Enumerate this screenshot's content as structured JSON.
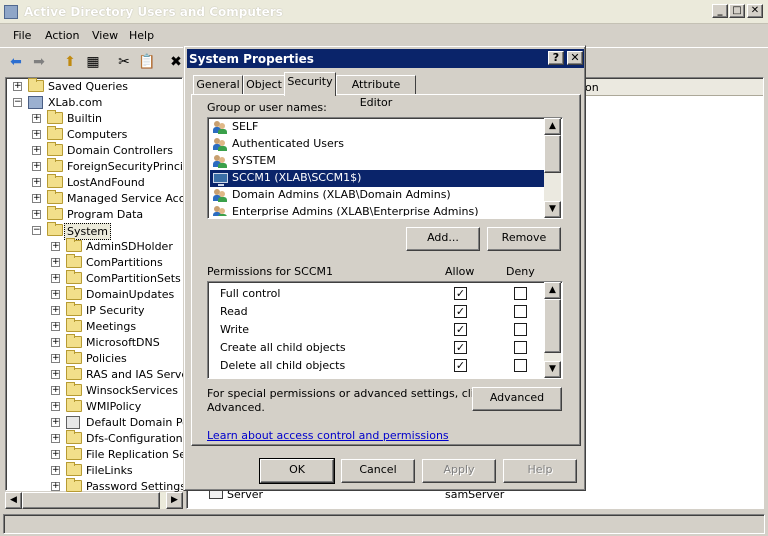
{
  "app": {
    "title": "Active Directory Users and Computers",
    "menu": [
      "File",
      "Action",
      "View",
      "Help"
    ]
  },
  "tree": {
    "nodes": [
      {
        "label": "Saved Queries",
        "level": 0,
        "expander": "+"
      },
      {
        "label": "XLab.com",
        "level": 0,
        "expander": "-",
        "icon": "domain"
      },
      {
        "label": "Builtin",
        "level": 1,
        "expander": "+"
      },
      {
        "label": "Computers",
        "level": 1,
        "expander": "+"
      },
      {
        "label": "Domain Controllers",
        "level": 1,
        "expander": "+"
      },
      {
        "label": "ForeignSecurityPrincipal",
        "level": 1,
        "expander": "+"
      },
      {
        "label": "LostAndFound",
        "level": 1,
        "expander": "+"
      },
      {
        "label": "Managed Service Accou",
        "level": 1,
        "expander": "+"
      },
      {
        "label": "Program Data",
        "level": 1,
        "expander": "+"
      },
      {
        "label": "System",
        "level": 1,
        "expander": "-",
        "selected": true
      },
      {
        "label": "AdminSDHolder",
        "level": 2,
        "expander": "+"
      },
      {
        "label": "ComPartitions",
        "level": 2,
        "expander": "+"
      },
      {
        "label": "ComPartitionSets",
        "level": 2,
        "expander": "+"
      },
      {
        "label": "DomainUpdates",
        "level": 2,
        "expander": "+"
      },
      {
        "label": "IP Security",
        "level": 2,
        "expander": "+"
      },
      {
        "label": "Meetings",
        "level": 2,
        "expander": "+"
      },
      {
        "label": "MicrosoftDNS",
        "level": 2,
        "expander": "+"
      },
      {
        "label": "Policies",
        "level": 2,
        "expander": "+"
      },
      {
        "label": "RAS and IAS Server",
        "level": 2,
        "expander": "+"
      },
      {
        "label": "WinsockServices",
        "level": 2,
        "expander": "+"
      },
      {
        "label": "WMIPolicy",
        "level": 2,
        "expander": "+"
      },
      {
        "label": "Default Domain Polic",
        "level": 2,
        "expander": "+",
        "icon": "policy"
      },
      {
        "label": "Dfs-Configuration",
        "level": 2,
        "expander": "+"
      },
      {
        "label": "File Replication Serv",
        "level": 2,
        "expander": "+"
      },
      {
        "label": "FileLinks",
        "level": 2,
        "expander": "+"
      },
      {
        "label": "Password Settings C",
        "level": 2,
        "expander": "+"
      }
    ]
  },
  "list": {
    "column_fragment": "on",
    "row": {
      "name": "Server",
      "type": "samServer"
    }
  },
  "dialog": {
    "title": "System Properties",
    "help_btn": "?",
    "close_btn": "✕",
    "tabs": [
      "General",
      "Object",
      "Security",
      "Attribute Editor"
    ],
    "active_tab": "Security",
    "group_label": "Group or user names:",
    "users": [
      {
        "name": "SELF",
        "icon": "users"
      },
      {
        "name": "Authenticated Users",
        "icon": "users"
      },
      {
        "name": "SYSTEM",
        "icon": "users"
      },
      {
        "name": "SCCM1 (XLAB\\SCCM1$)",
        "icon": "computer",
        "selected": true
      },
      {
        "name": "Domain Admins (XLAB\\Domain Admins)",
        "icon": "users"
      },
      {
        "name": "Enterprise Admins (XLAB\\Enterprise Admins)",
        "icon": "users"
      }
    ],
    "add_btn": "Add...",
    "remove_btn": "Remove",
    "perm_label": "Permissions for SCCM1",
    "allow_header": "Allow",
    "deny_header": "Deny",
    "permissions": [
      {
        "name": "Full control",
        "allow": true,
        "deny": false
      },
      {
        "name": "Read",
        "allow": true,
        "deny": false
      },
      {
        "name": "Write",
        "allow": true,
        "deny": false
      },
      {
        "name": "Create all child objects",
        "allow": true,
        "deny": false
      },
      {
        "name": "Delete all child objects",
        "allow": true,
        "deny": false
      }
    ],
    "special_text_1": "For special permissions or advanced settings, click",
    "special_text_2": "Advanced.",
    "advanced_btn": "Advanced",
    "learn_link": "Learn about access control and permissions",
    "ok_btn": "OK",
    "cancel_btn": "Cancel",
    "apply_btn": "Apply",
    "help_button": "Help"
  },
  "colors": {
    "selection": "#0a246a",
    "face": "#d4d0c8",
    "link": "#0000cc"
  }
}
